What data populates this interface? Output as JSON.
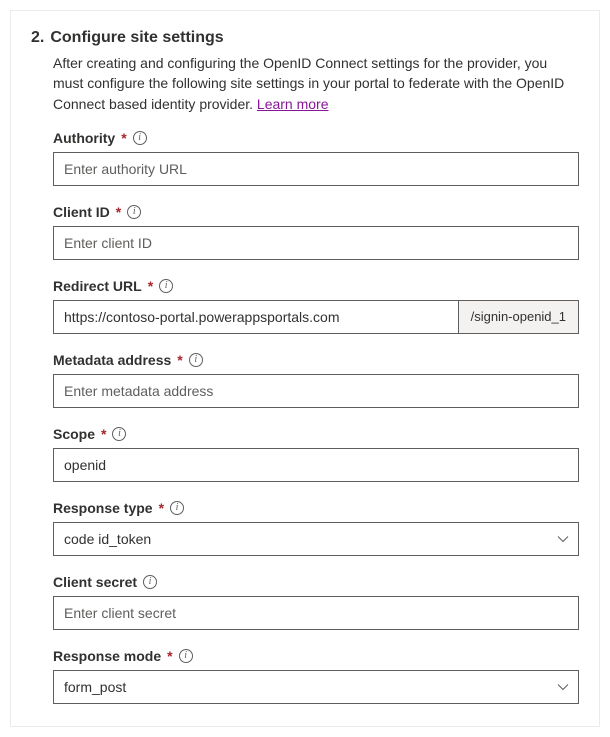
{
  "step": {
    "number": "2.",
    "title": "Configure site settings",
    "description": "After creating and configuring the OpenID Connect settings for the provider, you must configure the following site settings in your portal to federate with the OpenID Connect based identity provider. ",
    "learn_more": "Learn more"
  },
  "fields": {
    "authority": {
      "label": "Authority",
      "placeholder": "Enter authority URL",
      "value": "",
      "required": true
    },
    "client_id": {
      "label": "Client ID",
      "placeholder": "Enter client ID",
      "value": "",
      "required": true
    },
    "redirect_url": {
      "label": "Redirect URL",
      "value": "https://contoso-portal.powerappsportals.com",
      "suffix": "/signin-openid_1",
      "required": true
    },
    "metadata": {
      "label": "Metadata address",
      "placeholder": "Enter metadata address",
      "value": "",
      "required": true
    },
    "scope": {
      "label": "Scope",
      "value": "openid",
      "required": true
    },
    "response_type": {
      "label": "Response type",
      "value": "code id_token",
      "required": true
    },
    "client_secret": {
      "label": "Client secret",
      "placeholder": "Enter client secret",
      "value": "",
      "required": false
    },
    "response_mode": {
      "label": "Response mode",
      "value": "form_post",
      "required": true
    }
  }
}
